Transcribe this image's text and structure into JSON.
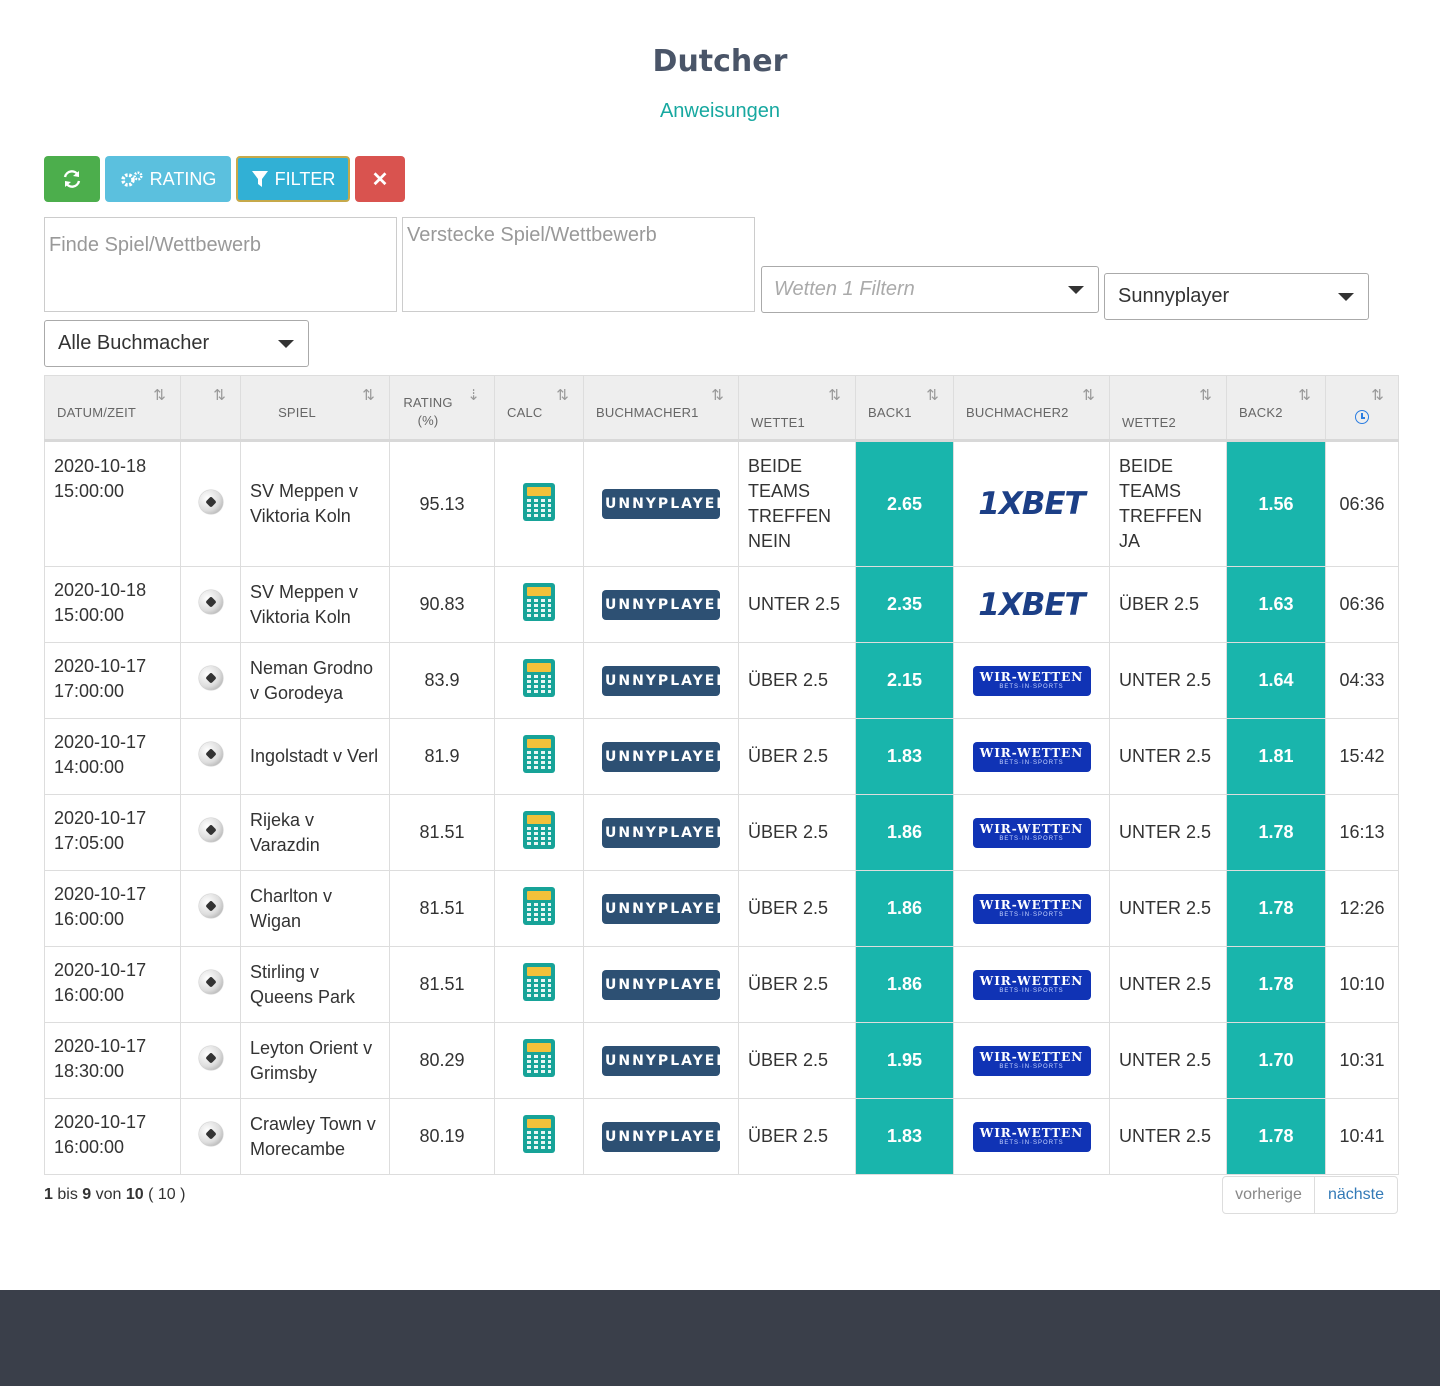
{
  "page": {
    "title": "Dutcher",
    "instructions_link": "Anweisungen"
  },
  "toolbar": {
    "refresh_icon": "refresh-icon",
    "rating_label": "RATING",
    "filter_label": "FILTER",
    "clear_label": "✕"
  },
  "search": {
    "find_placeholder": "Finde Spiel/Wettbewerb",
    "hide_placeholder": "Verstecke Spiel/Wettbewerb"
  },
  "selects": {
    "wetten_placeholder": "Wetten 1 Filtern",
    "bookmaker_value": "Sunnyplayer",
    "all_bookmakers_value": "Alle Buchmacher"
  },
  "table": {
    "headers": {
      "datum": "DATUM/ZEIT",
      "spiel": "SPIEL",
      "rating": "RATING",
      "rating_unit": "(%)",
      "calc": "CALC",
      "buch1": "BUCHMACHER1",
      "wette1": "WETTE1",
      "back1": "BACK1",
      "buch2": "BUCHMACHER2",
      "wette2": "WETTE2",
      "back2": "BACK2"
    },
    "rows": [
      {
        "date": "2020-10-18",
        "time": "15:00:00",
        "game": "SV Meppen v Viktoria Koln",
        "rating": "95.13",
        "book1": "SUNNYPLAYER",
        "bet1": "BEIDE TEAMS TREFFEN NEIN",
        "back1": "2.65",
        "book2": "1XBET",
        "bet2": "BEIDE TEAMS TREFFEN JA",
        "back2": "1.56",
        "age": "06:36"
      },
      {
        "date": "2020-10-18",
        "time": "15:00:00",
        "game": "SV Meppen v Viktoria Koln",
        "rating": "90.83",
        "book1": "SUNNYPLAYER",
        "bet1": "UNTER 2.5",
        "back1": "2.35",
        "book2": "1XBET",
        "bet2": "ÜBER 2.5",
        "back2": "1.63",
        "age": "06:36"
      },
      {
        "date": "2020-10-17",
        "time": "17:00:00",
        "game": "Neman Grodno v Gorodeya",
        "rating": "83.9",
        "book1": "SUNNYPLAYER",
        "bet1": "ÜBER 2.5",
        "back1": "2.15",
        "book2": "WIR-WETTEN",
        "bet2": "UNTER 2.5",
        "back2": "1.64",
        "age": "04:33"
      },
      {
        "date": "2020-10-17",
        "time": "14:00:00",
        "game": "Ingolstadt v Verl",
        "rating": "81.9",
        "book1": "SUNNYPLAYER",
        "bet1": "ÜBER 2.5",
        "back1": "1.83",
        "book2": "WIR-WETTEN",
        "bet2": "UNTER 2.5",
        "back2": "1.81",
        "age": "15:42"
      },
      {
        "date": "2020-10-17",
        "time": "17:05:00",
        "game": "Rijeka v Varazdin",
        "rating": "81.51",
        "book1": "SUNNYPLAYER",
        "bet1": "ÜBER 2.5",
        "back1": "1.86",
        "book2": "WIR-WETTEN",
        "bet2": "UNTER 2.5",
        "back2": "1.78",
        "age": "16:13"
      },
      {
        "date": "2020-10-17",
        "time": "16:00:00",
        "game": "Charlton v Wigan",
        "rating": "81.51",
        "book1": "SUNNYPLAYER",
        "bet1": "ÜBER 2.5",
        "back1": "1.86",
        "book2": "WIR-WETTEN",
        "bet2": "UNTER 2.5",
        "back2": "1.78",
        "age": "12:26"
      },
      {
        "date": "2020-10-17",
        "time": "16:00:00",
        "game": "Stirling v Queens Park",
        "rating": "81.51",
        "book1": "SUNNYPLAYER",
        "bet1": "ÜBER 2.5",
        "back1": "1.86",
        "book2": "WIR-WETTEN",
        "bet2": "UNTER 2.5",
        "back2": "1.78",
        "age": "10:10"
      },
      {
        "date": "2020-10-17",
        "time": "18:30:00",
        "game": "Leyton Orient v Grimsby",
        "rating": "80.29",
        "book1": "SUNNYPLAYER",
        "bet1": "ÜBER 2.5",
        "back1": "1.95",
        "book2": "WIR-WETTEN",
        "bet2": "UNTER 2.5",
        "back2": "1.70",
        "age": "10:31"
      },
      {
        "date": "2020-10-17",
        "time": "16:00:00",
        "game": "Crawley Town v Morecambe",
        "rating": "80.19",
        "book1": "SUNNYPLAYER",
        "bet1": "ÜBER 2.5",
        "back1": "1.83",
        "book2": "WIR-WETTEN",
        "bet2": "UNTER 2.5",
        "back2": "1.78",
        "age": "10:41"
      }
    ]
  },
  "pagination": {
    "from": "1",
    "bis": "bis",
    "to": "9",
    "von": "von",
    "total": "10",
    "filtered": "( 10 )",
    "prev_label": "vorherige",
    "next_label": "nächste"
  },
  "colors": {
    "accent": "#17a8a0",
    "odds_cell": "#19b5ac",
    "footer": "#3a3f4a"
  }
}
